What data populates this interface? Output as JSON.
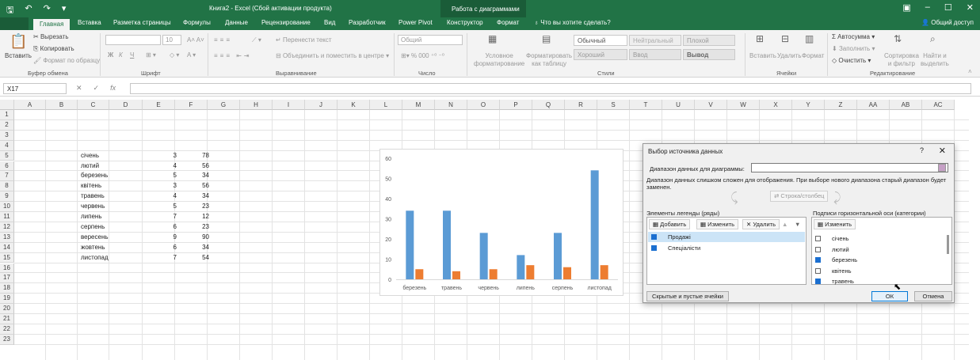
{
  "titlebar": {
    "title": "Книга2 - Excel (Сбой активации продукта)",
    "context_tab": "Работа с диаграммами",
    "share": "Общий доступ"
  },
  "tabs": [
    "Главная",
    "Вставка",
    "Разметка страницы",
    "Формулы",
    "Данные",
    "Рецензирование",
    "Вид",
    "Разработчик",
    "Power Pivot",
    "Конструктор",
    "Формат"
  ],
  "tellme": "Что вы хотите сделать?",
  "ribbon": {
    "paste": "Вставить",
    "cut": "Вырезать",
    "copy": "Копировать",
    "format_painter": "Формат по образцу",
    "clipboard_group": "Буфер обмена",
    "font_size": "10",
    "bold": "Ж",
    "italic": "К",
    "underline": "Ч",
    "font_group": "Шрифт",
    "wrap_text": "Перенести текст",
    "merge_center": "Объединить и поместить в центре",
    "alignment_group": "Выравнивание",
    "number_format": "Общий",
    "number_group": "Число",
    "conditional_format": [
      "Условное",
      "форматирование"
    ],
    "format_table": [
      "Форматировать",
      "как таблицу"
    ],
    "styles": [
      "Обычный",
      "Нейтральный",
      "Плохой",
      "Хороший",
      "Ввод",
      "Вывод"
    ],
    "styles_group": "Стили",
    "cell_insert": "Вставить",
    "cell_delete": "Удалить",
    "cell_format": "Формат",
    "cells_group": "Ячейки",
    "autosum": "Автосумма",
    "fill": "Заполнить",
    "clear": "Очистить",
    "sort_filter": [
      "Сортировка",
      "и фильтр"
    ],
    "find_select": [
      "Найти и",
      "выделить"
    ],
    "editing_group": "Редактирование"
  },
  "formula_bar": {
    "name_box": "X17",
    "fx": "fx",
    "cancel": "✕",
    "enter": "✓"
  },
  "columns": [
    "A",
    "B",
    "C",
    "D",
    "E",
    "F",
    "G",
    "H",
    "I",
    "J",
    "K",
    "L",
    "M",
    "N",
    "O",
    "P",
    "Q",
    "R",
    "S",
    "T",
    "U",
    "V",
    "W",
    "X",
    "Y",
    "Z",
    "AA",
    "AB",
    "AC"
  ],
  "rows": [
    "1",
    "2",
    "3",
    "4",
    "5",
    "6",
    "7",
    "8",
    "9",
    "10",
    "11",
    "12",
    "13",
    "14",
    "15",
    "16",
    "17",
    "18",
    "19",
    "20",
    "21",
    "22",
    "23"
  ],
  "sheet": [
    {
      "month": "січень",
      "e": "3",
      "f": "78"
    },
    {
      "month": "лютий",
      "e": "4",
      "f": "56"
    },
    {
      "month": "березень",
      "e": "5",
      "f": "34"
    },
    {
      "month": "квітень",
      "e": "3",
      "f": "56"
    },
    {
      "month": "травень",
      "e": "4",
      "f": "34"
    },
    {
      "month": "червень",
      "e": "5",
      "f": "23"
    },
    {
      "month": "липень",
      "e": "7",
      "f": "12"
    },
    {
      "month": "серпень",
      "e": "6",
      "f": "23"
    },
    {
      "month": "вересень",
      "e": "9",
      "f": "90"
    },
    {
      "month": "жовтень",
      "e": "6",
      "f": "34"
    },
    {
      "month": "листопад",
      "e": "7",
      "f": "54"
    }
  ],
  "chart_data": {
    "type": "bar",
    "categories": [
      "березень",
      "травень",
      "червень",
      "липень",
      "серпень",
      "листопад"
    ],
    "series": [
      {
        "values": [
          34,
          34,
          23,
          12,
          23,
          54
        ],
        "color": "#5b9bd5"
      },
      {
        "values": [
          5,
          4,
          5,
          7,
          6,
          7
        ],
        "color": "#ed7d31"
      }
    ],
    "ylim": [
      0,
      60
    ],
    "yticks": [
      "0",
      "10",
      "20",
      "30",
      "40",
      "50",
      "60"
    ],
    "grid": false,
    "title": "",
    "xlabel": "",
    "ylabel": ""
  },
  "dialog": {
    "title": "Выбор источника данных",
    "help": "?",
    "close": "✕",
    "range_label": "Диапазон данных для диаграммы:",
    "warning_1": "Диапазон данных слишком сложен для отображения. При выборе нового диапазона старый диапазон будет",
    "warning_2": "заменен.",
    "switch": "Строка/столбец",
    "legend_label": "Элементы легенды (ряды)",
    "add": "Добавить",
    "edit": "Изменить",
    "remove": "Удалить",
    "series": [
      "Продажі",
      "Спеціалісти"
    ],
    "axis_label": "Подписи горизонтальной оси (категории)",
    "axis_edit": "Изменить",
    "categories": [
      {
        "label": "січень",
        "checked": false
      },
      {
        "label": "лютий",
        "checked": false
      },
      {
        "label": "березень",
        "checked": true
      },
      {
        "label": "квітень",
        "checked": false
      },
      {
        "label": "травень",
        "checked": true
      }
    ],
    "hidden_cells": "Скрытые и пустые ячейки",
    "ok": "ОК",
    "cancel": "Отмена"
  }
}
